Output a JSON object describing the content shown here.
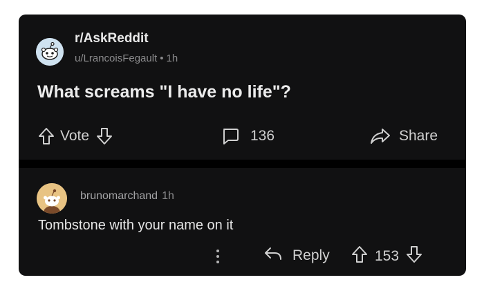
{
  "post": {
    "subreddit": "r/AskReddit",
    "author": "u/LrancoisFegault",
    "separator": "•",
    "age": "1h",
    "title": "What screams \"I have no life\"?",
    "vote_label": "Vote",
    "comment_count": "136",
    "share_label": "Share"
  },
  "comment": {
    "username": "brunomarchand",
    "age": "1h",
    "body": "Tombstone with your name on it",
    "reply_label": "Reply",
    "score": "153"
  },
  "colors": {
    "card_bg": "#111112",
    "divider": "#000000",
    "text_primary": "#ececec",
    "text_muted": "#8b8b8d",
    "subreddit_avatar": "#cfe2f0",
    "user_avatar": "#e8c383"
  },
  "icons": {
    "subreddit_avatar": "snoo-avatar-icon",
    "user_avatar": "snoo-avatar-icon",
    "upvote": "arrow-up-icon",
    "downvote": "arrow-down-icon",
    "comments": "comment-bubble-icon",
    "share": "share-arrow-icon",
    "reply": "reply-arrow-icon",
    "more": "more-vertical-icon"
  }
}
